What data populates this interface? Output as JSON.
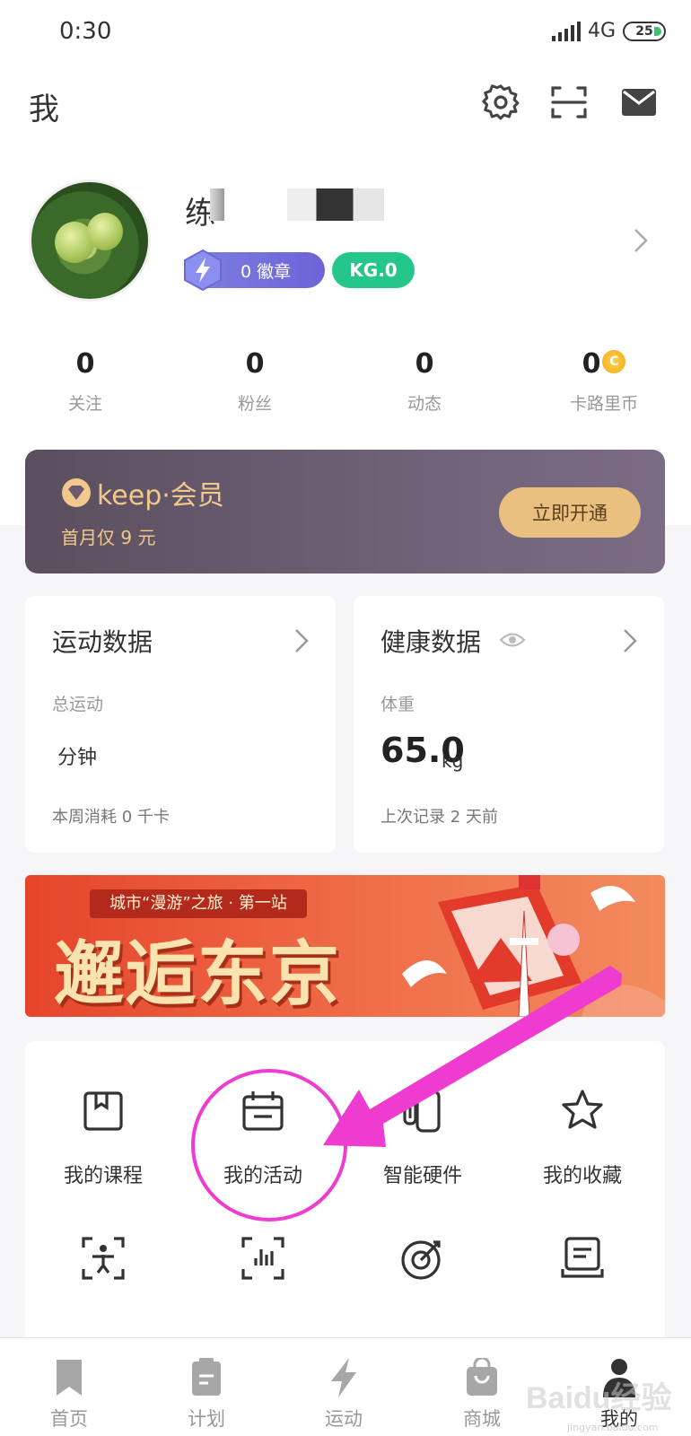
{
  "status_bar": {
    "time": "0:30",
    "network": "4G",
    "battery": "25"
  },
  "header": {
    "title": "我",
    "icons": [
      "gear-icon",
      "scan-icon",
      "mail-icon"
    ]
  },
  "profile": {
    "name_visible": "练",
    "badge_label": "0 徽章",
    "kg_label": "KG.0"
  },
  "stats": [
    {
      "value": "0",
      "label": "关注"
    },
    {
      "value": "0",
      "label": "粉丝"
    },
    {
      "value": "0",
      "label": "动态"
    },
    {
      "value": "0",
      "label": "卡路里币",
      "coin": "C"
    }
  ],
  "vip": {
    "logo_text": "keep·会员",
    "subtitle": "首月仅 9 元",
    "button": "立即开通"
  },
  "sport_card": {
    "title": "运动数据",
    "label": "总运动",
    "value": "分钟",
    "footer": "本周消耗 0 千卡"
  },
  "health_card": {
    "title": "健康数据",
    "label": "体重",
    "value": "65.0",
    "unit": "kg",
    "footer": "上次记录 2 天前"
  },
  "promo": {
    "tag": "城市“漫游”之旅 · 第一站",
    "title": "邂逅东京"
  },
  "grid": {
    "row1": [
      {
        "label": "我的课程",
        "icon": "bookmark-book-icon"
      },
      {
        "label": "我的活动",
        "icon": "calendar-icon"
      },
      {
        "label": "智能硬件",
        "icon": "hardware-icon"
      },
      {
        "label": "我的收藏",
        "icon": "star-icon"
      }
    ],
    "row2_icons": [
      "body-scan-icon",
      "data-scan-icon",
      "target-icon",
      "records-icon"
    ]
  },
  "tabbar": [
    {
      "label": "首页",
      "icon": "bookmark-icon"
    },
    {
      "label": "计划",
      "icon": "clipboard-icon"
    },
    {
      "label": "运动",
      "icon": "lightning-icon"
    },
    {
      "label": "商城",
      "icon": "shopping-bag-icon"
    },
    {
      "label": "我的",
      "icon": "person-icon",
      "active": true
    }
  ],
  "watermark": {
    "text": "Baidu经验",
    "sub": "jingyan.baidu.com"
  },
  "colors": {
    "vip_gold": "#eac080",
    "kg_green": "#24c789",
    "badge_purple": "#6d63d8",
    "annotation": "#ee3bd0"
  }
}
